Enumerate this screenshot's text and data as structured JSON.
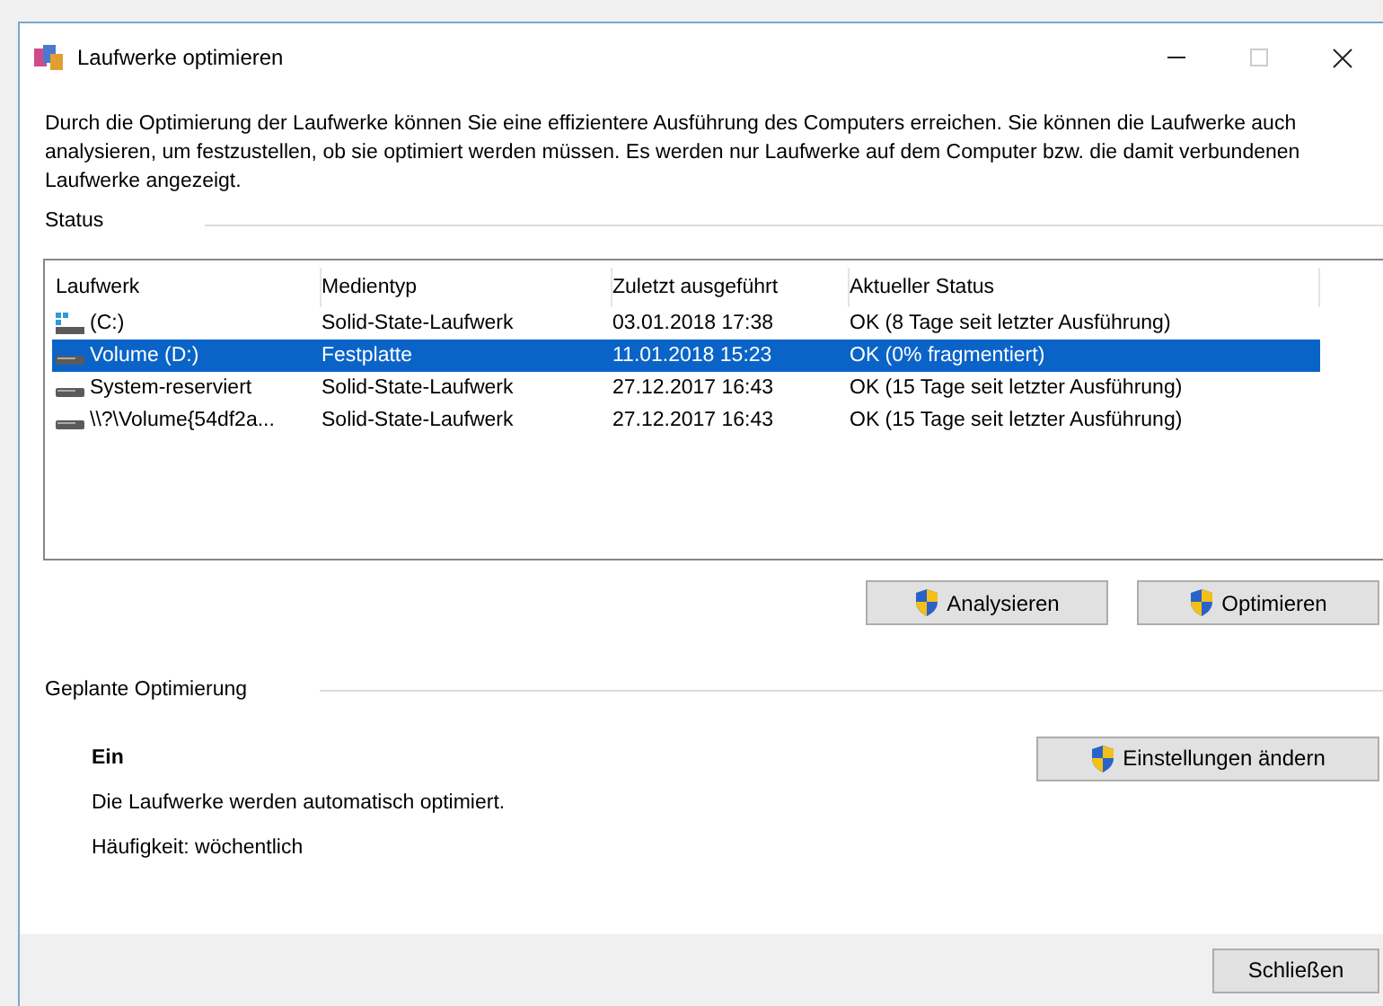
{
  "window": {
    "title": "Laufwerke optimieren"
  },
  "description": "Durch die Optimierung der Laufwerke können Sie eine effizientere Ausführung des Computers erreichen. Sie können die Laufwerke auch analysieren, um festzustellen, ob sie optimiert werden müssen. Es werden nur Laufwerke auf dem Computer bzw. die damit verbundenen Laufwerke angezeigt.",
  "status_label": "Status",
  "table": {
    "columns": [
      "Laufwerk",
      "Medientyp",
      "Zuletzt ausgeführt",
      "Aktueller Status"
    ],
    "rows": [
      {
        "kind": "system",
        "cells": [
          "(C:)",
          "Solid-State-Laufwerk",
          "03.01.2018 17:38",
          "OK (8 Tage seit letzter Ausführung)"
        ],
        "selected": false
      },
      {
        "kind": "drive",
        "cells": [
          "Volume (D:)",
          "Festplatte",
          "11.01.2018 15:23",
          "OK (0% fragmentiert)"
        ],
        "selected": true
      },
      {
        "kind": "drive",
        "cells": [
          "System-reserviert",
          "Solid-State-Laufwerk",
          "27.12.2017 16:43",
          "OK (15 Tage seit letzter Ausführung)"
        ],
        "selected": false
      },
      {
        "kind": "drive",
        "cells": [
          "\\\\?\\Volume{54df2a...",
          "Solid-State-Laufwerk",
          "27.12.2017 16:43",
          "OK (15 Tage seit letzter Ausführung)"
        ],
        "selected": false
      }
    ]
  },
  "actions": [
    "Analysieren",
    "Optimieren"
  ],
  "scheduled": {
    "label": "Geplante Optimierung",
    "state": "Ein",
    "text": "Die Laufwerke werden automatisch optimiert.",
    "frequency": "Häufigkeit: wöchentlich",
    "button": "Einstellungen ändern"
  },
  "close_button": "Schließen"
}
